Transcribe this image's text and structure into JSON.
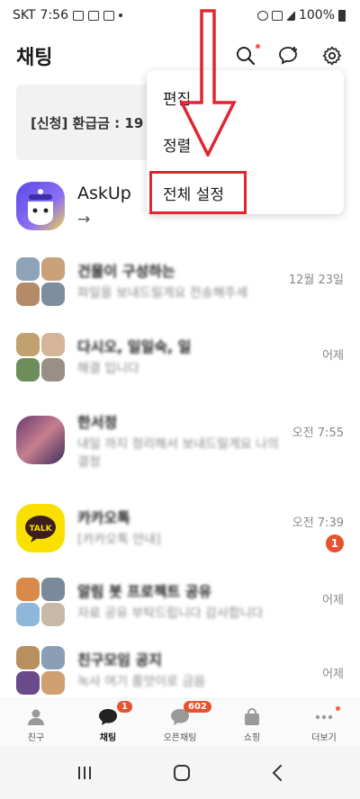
{
  "status_bar": {
    "carrier": "SKT",
    "time": "7:56",
    "battery": "100%"
  },
  "header": {
    "title": "채팅"
  },
  "banner": {
    "text": "[신청] 환급금 : 19"
  },
  "dropdown": {
    "items": [
      "편집",
      "정렬",
      "전체 설정"
    ]
  },
  "chats": [
    {
      "name": "AskUp",
      "message": "→",
      "time": "",
      "badge": ""
    },
    {
      "name": "건물이 구성하는",
      "message": "파일을 보내드릴게요 전송해주세",
      "time": "12월 23일",
      "badge": ""
    },
    {
      "name": "다시오, 일일숙, 일",
      "message": "해결 입니다",
      "time": "어제",
      "badge": ""
    },
    {
      "name": "한서정",
      "message": "내일 까지 정리해서 보내드릴게요 나의 결정",
      "time": "오전 7:55",
      "badge": ""
    },
    {
      "name": "카카오톡",
      "message": "[카카오톡 안내]",
      "time": "오전 7:39",
      "badge": "1"
    },
    {
      "name": "알림 봇 프로젝트 공유",
      "message": "자료 공유 부탁드립니다 감사합니다",
      "time": "어제",
      "badge": ""
    },
    {
      "name": "친구모임 공지",
      "message": "녹사 여기 품앗이로 금음",
      "time": "어제",
      "badge": ""
    }
  ],
  "bottom_nav": [
    {
      "label": "친구",
      "badge": ""
    },
    {
      "label": "채팅",
      "badge": "1"
    },
    {
      "label": "오픈채팅",
      "badge": "602"
    },
    {
      "label": "쇼핑",
      "badge": ""
    },
    {
      "label": "더보기",
      "badge": ""
    }
  ],
  "colors": {
    "accent": "#e5532f",
    "highlight": "#e0262f",
    "annotation_arrow": "#e0262f"
  }
}
